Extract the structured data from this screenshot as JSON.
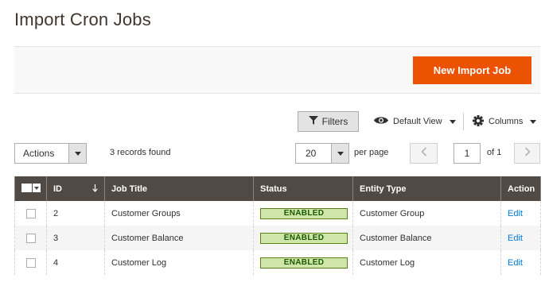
{
  "page": {
    "title": "Import Cron Jobs"
  },
  "actions": {
    "new_button": "New Import Job"
  },
  "toolbar": {
    "filters_label": "Filters",
    "view_label": "Default View",
    "columns_label": "Columns"
  },
  "paging": {
    "mass_action_label": "Actions",
    "records_found": "3 records found",
    "per_page_value": "20",
    "per_page_label": "per page",
    "current_page": "1",
    "total_pages": "of 1"
  },
  "grid": {
    "columns": {
      "id": "ID",
      "job_title": "Job Title",
      "status": "Status",
      "entity_type": "Entity Type",
      "action": "Action"
    },
    "rows": [
      {
        "id": "2",
        "job_title": "Customer Groups",
        "status": "ENABLED",
        "entity_type": "Customer Group",
        "action": "Edit"
      },
      {
        "id": "3",
        "job_title": "Customer Balance",
        "status": "ENABLED",
        "entity_type": "Customer Balance",
        "action": "Edit"
      },
      {
        "id": "4",
        "job_title": "Customer Log",
        "status": "ENABLED",
        "entity_type": "Customer Log",
        "action": "Edit"
      }
    ]
  },
  "colors": {
    "accent": "#eb5202",
    "header_bg": "#514943",
    "link": "#007bdb",
    "status_enabled_bg": "#d0e5a9",
    "status_enabled_text": "#185b00"
  },
  "icons": {
    "filter": "filter-icon",
    "view": "eye-icon",
    "columns": "gear-icon",
    "sort": "arrow-down-icon",
    "prev": "chevron-left-icon",
    "next": "chevron-right-icon"
  }
}
